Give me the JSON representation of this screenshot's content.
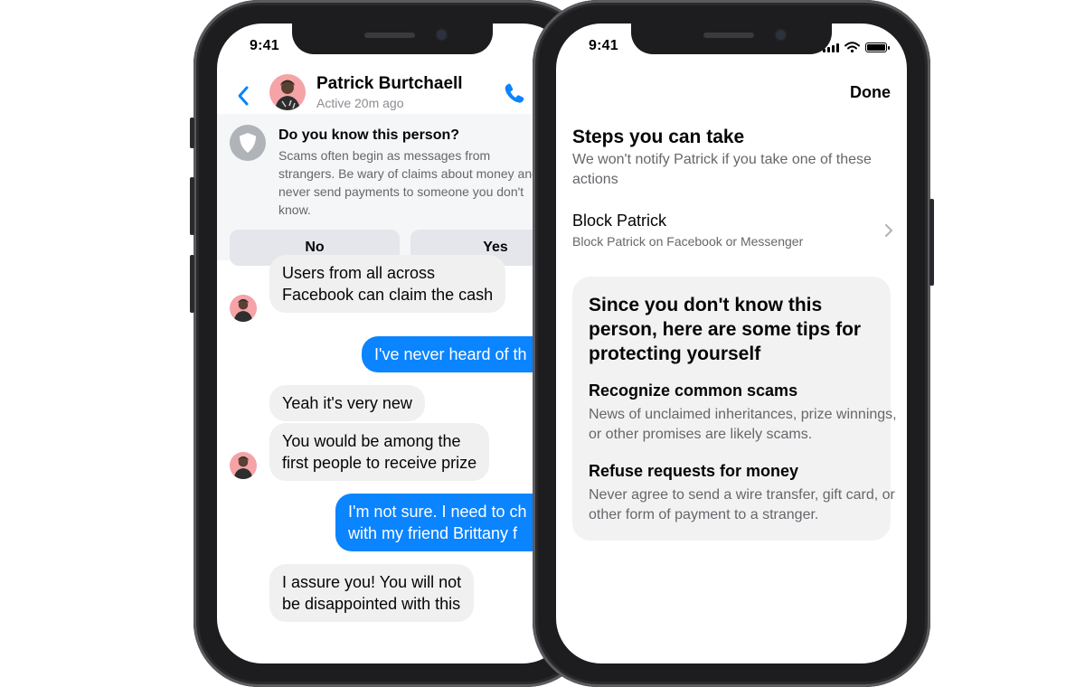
{
  "status_bar": {
    "time": "9:41"
  },
  "chat": {
    "contact_name": "Patrick Burtchaell",
    "contact_status": "Active 20m ago",
    "warning": {
      "title": "Do you know this person?",
      "body": "Scams often begin as messages from strangers. Be wary of claims about money and never send payments to someone you don't know.",
      "no_label": "No",
      "yes_label": "Yes"
    },
    "messages": [
      {
        "dir": "in",
        "lines": [
          "Users from all across",
          "Facebook can claim the cash"
        ]
      },
      {
        "dir": "out",
        "lines": [
          "I've never heard of th"
        ]
      },
      {
        "dir": "in",
        "lines": [
          "Yeah it's very new"
        ]
      },
      {
        "dir": "in",
        "lines": [
          "You would be among the",
          "first people to receive prize"
        ]
      },
      {
        "dir": "out",
        "lines": [
          "I'm not sure. I need to ch",
          "with my friend Brittany f"
        ]
      },
      {
        "dir": "in",
        "lines": [
          "I assure you! You will not",
          "be disappointed with this"
        ]
      }
    ]
  },
  "safety": {
    "done_label": "Done",
    "steps_title": "Steps you can take",
    "steps_subtitle": "We won't notify Patrick if you take one of these actions",
    "block_title": "Block Patrick",
    "block_subtitle": "Block Patrick on Facebook or Messenger",
    "tips_title": "Since you don't know this person, here are some tips for protecting yourself",
    "tips": [
      {
        "heading": "Recognize common scams",
        "body": "News of unclaimed inheritances, prize winnings, or other promises are likely scams."
      },
      {
        "heading": "Refuse requests for money",
        "body": "Never agree to send a wire transfer, gift card, or other form of payment to a stranger."
      }
    ]
  },
  "colors": {
    "accent": "#0a84ff",
    "frame": "#1d1d1f",
    "bubble_in": "#f0f0f0",
    "avatar_bg": "#f5a3a7"
  }
}
